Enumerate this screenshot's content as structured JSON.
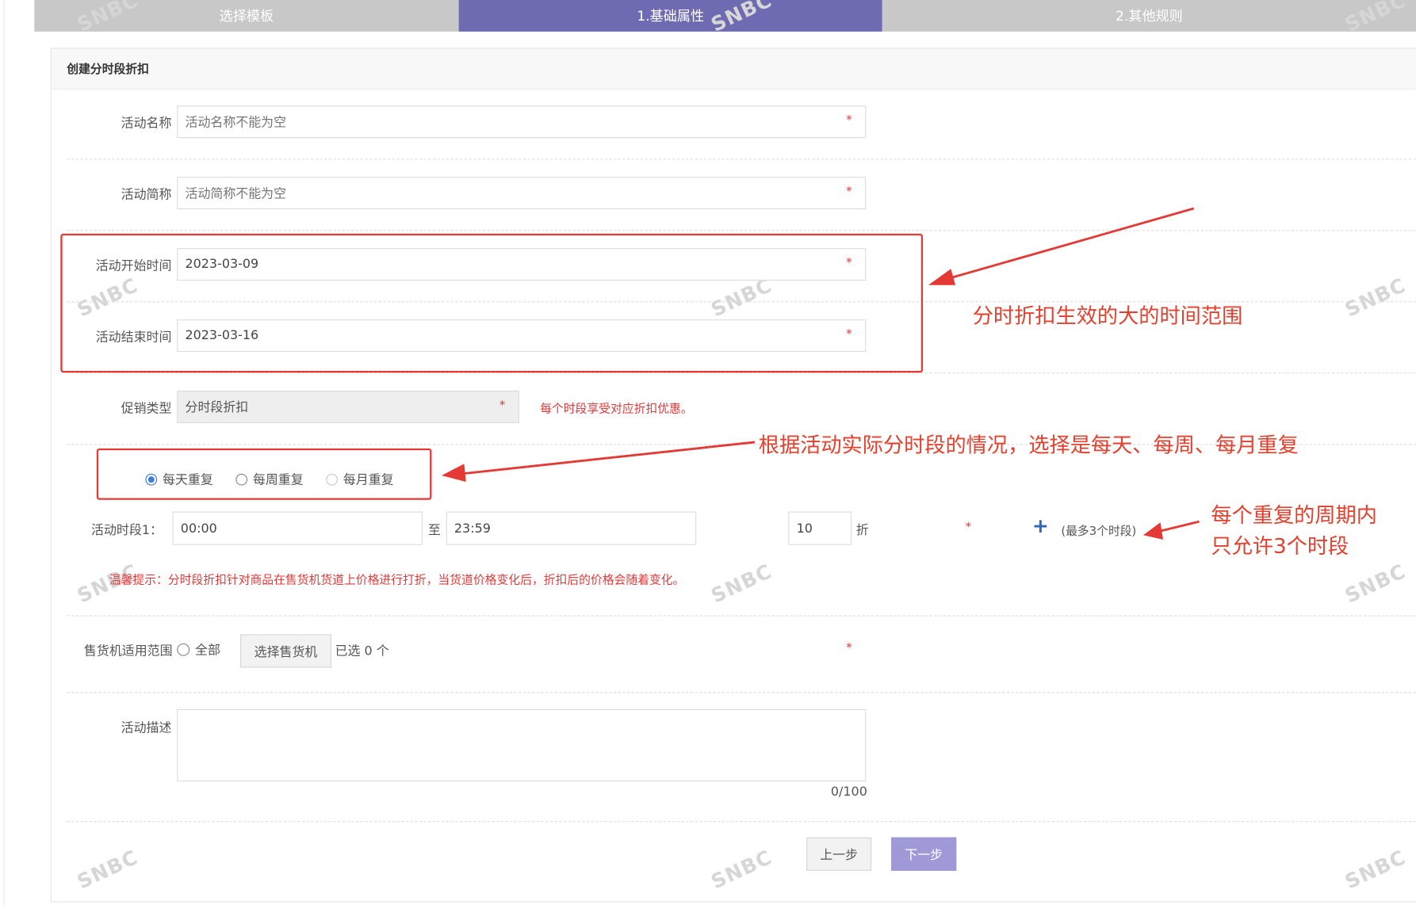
{
  "steps": [
    "选择模板",
    "1.基础属性",
    "2.其他规则"
  ],
  "panel_title": "创建分时段折扣",
  "form": {
    "name": {
      "label": "活动名称",
      "placeholder": "活动名称不能为空"
    },
    "short_name": {
      "label": "活动简称",
      "placeholder": "活动简称不能为空"
    },
    "start": {
      "label": "活动开始时间",
      "value": "2023-03-09"
    },
    "end": {
      "label": "活动结束时间",
      "value": "2023-03-16"
    },
    "promo": {
      "label": "促销类型",
      "value": "分时段折扣",
      "hint": "每个时段享受对应折扣优惠。"
    },
    "repeat": {
      "options": [
        "每天重复",
        "每周重复",
        "每月重复"
      ],
      "selected": "每天重复"
    },
    "period": {
      "label": "活动时段1：",
      "start": "00:00",
      "to": "至",
      "end": "23:59",
      "discount": "10",
      "unit": "折",
      "max_hint": "(最多3个时段)"
    },
    "tip": "温馨提示：分时段折扣针对商品在售货机货道上价格进行打折，当货道价格变化后，折扣后的价格会随着变化。",
    "scope": {
      "label": "售货机适用范围",
      "all": "全部",
      "select_button": "选择售货机",
      "selected_text": "已选 0 个"
    },
    "desc": {
      "label": "活动描述",
      "counter": "0/100"
    }
  },
  "buttons": {
    "prev": "上一步",
    "next": "下一步"
  },
  "annotations": {
    "time_range": "分时折扣生效的大的时间范围",
    "repeat_choice": "根据活动实际分时段的情况，选择是每天、每周、每月重复",
    "max_periods_line1": "每个重复的周期内",
    "max_periods_line2": "只允许3个时段"
  },
  "required_mark": "*",
  "watermark": "SNBC",
  "colors": {
    "step_active": "#6f6bb3",
    "step_inactive": "#c8c8c8",
    "annotation_red": "#e53935",
    "next_button": "#9f99d7"
  }
}
